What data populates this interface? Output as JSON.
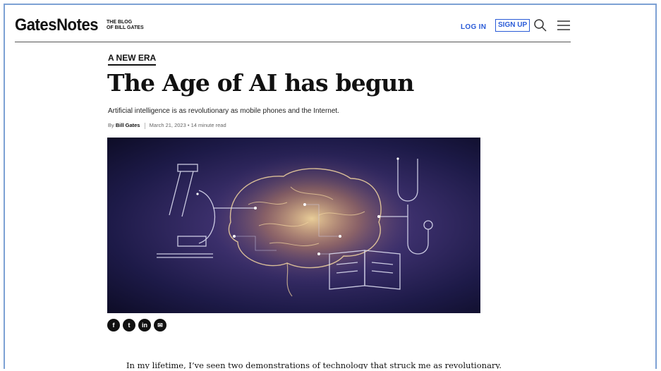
{
  "header": {
    "logo": "GatesNotes",
    "tagline_line1": "THE BLOG",
    "tagline_line2": "OF BILL GATES",
    "login_label": "LOG IN",
    "signup_label": "SIGN UP"
  },
  "article": {
    "kicker": "A NEW ERA",
    "title": "The Age of AI has begun",
    "subtitle": "Artificial intelligence is as revolutionary as mobile phones and the Internet.",
    "by_prefix": "By",
    "author": "Bill Gates",
    "date": "March 21, 2023",
    "dot": "•",
    "read_time": "14 minute read",
    "first_paragraph": "In my lifetime, I’ve seen two demonstrations of technology that struck me as revolutionary."
  },
  "share": {
    "facebook": "f",
    "twitter": "t",
    "linkedin": "in",
    "email": "✉"
  },
  "colors": {
    "accent_blue": "#2a5bd7",
    "frame_border": "#7da1d4",
    "hero_dark": "#1d1a48",
    "hero_glow": "#f3d08a"
  },
  "icons": [
    "search-icon",
    "menu-icon",
    "facebook-icon",
    "twitter-icon",
    "linkedin-icon",
    "email-icon"
  ]
}
